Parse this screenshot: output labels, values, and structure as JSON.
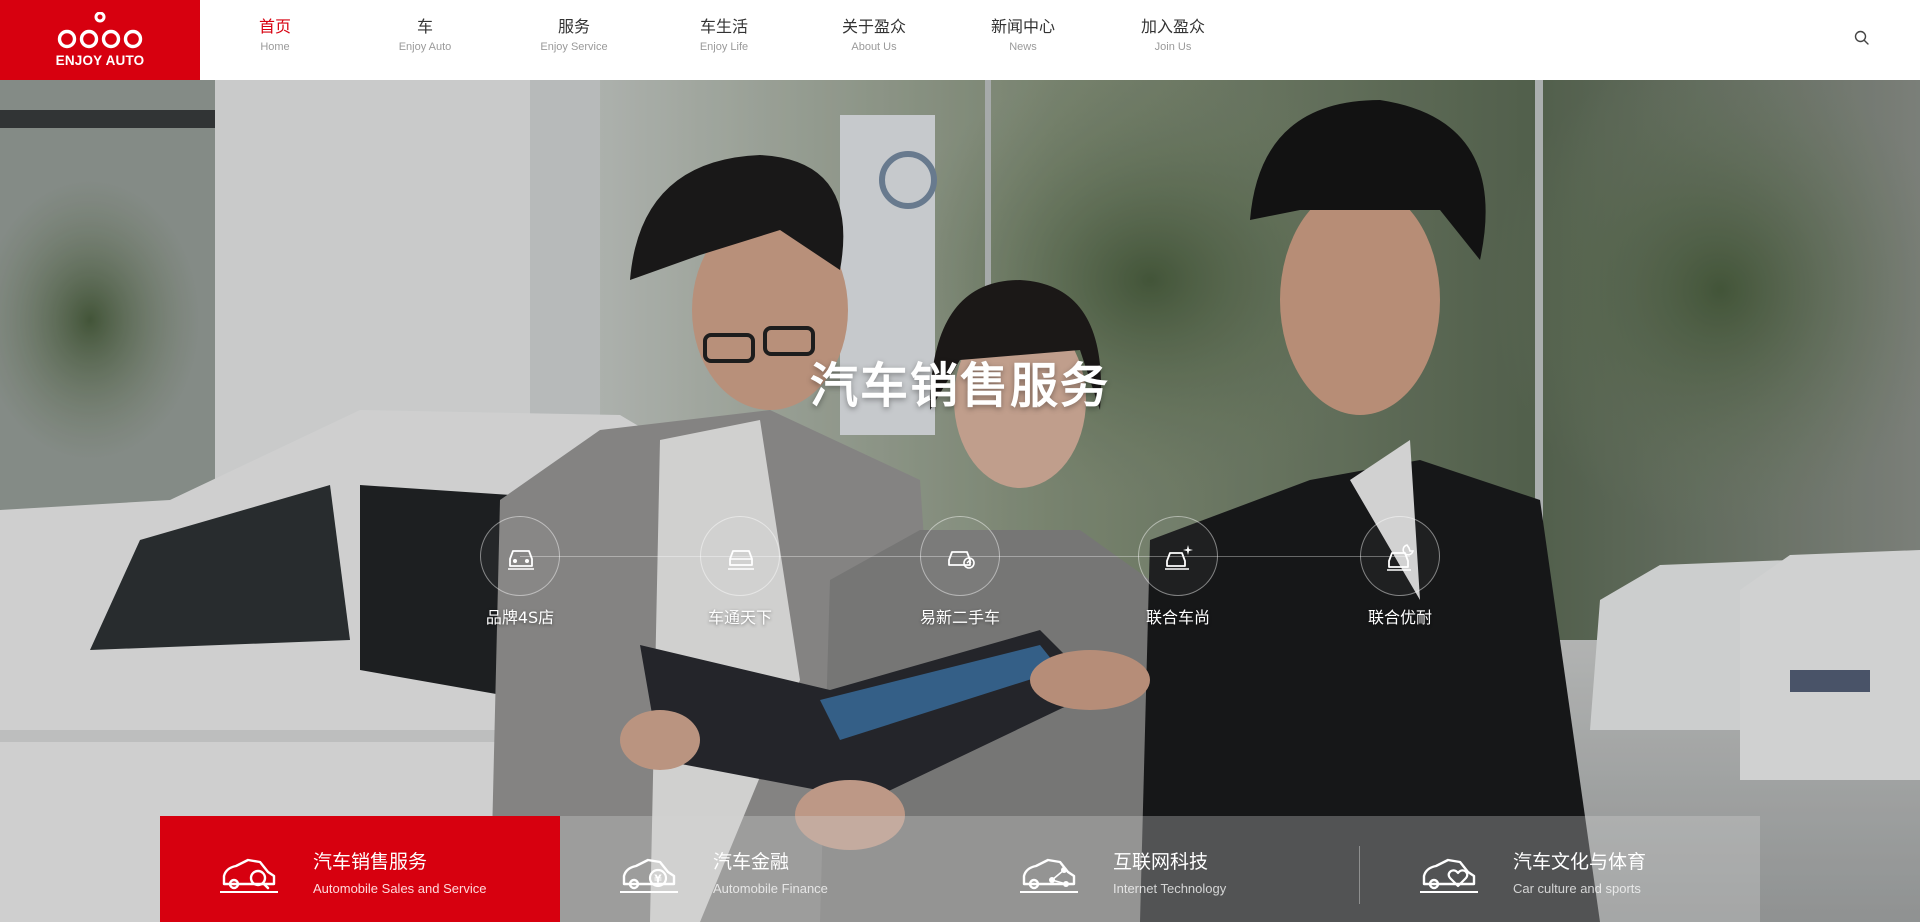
{
  "logo": {
    "text": "ENJOY AUTO"
  },
  "nav": {
    "items": [
      {
        "cn": "首页",
        "en": "Home",
        "active": true
      },
      {
        "cn": "车",
        "en": "Enjoy Auto"
      },
      {
        "cn": "服务",
        "en": "Enjoy Service"
      },
      {
        "cn": "车生活",
        "en": "Enjoy Life"
      },
      {
        "cn": "关于盈众",
        "en": "About Us"
      },
      {
        "cn": "新闻中心",
        "en": "News"
      },
      {
        "cn": "加入盈众",
        "en": "Join Us"
      }
    ],
    "search_icon": "search-icon"
  },
  "hero": {
    "title": "汽车销售服务",
    "services": [
      {
        "label": "品牌4S店",
        "icon": "car-front-icon"
      },
      {
        "label": "车通天下",
        "icon": "car-globe-icon"
      },
      {
        "label": "易新二手车",
        "icon": "car-exchange-icon"
      },
      {
        "label": "联合车尚",
        "icon": "car-sparkle-icon"
      },
      {
        "label": "联合优耐",
        "icon": "car-wrench-icon"
      }
    ]
  },
  "categories": [
    {
      "cn": "汽车销售服务",
      "en": "Automobile Sales and Service",
      "icon": "car-search-icon",
      "active": true
    },
    {
      "cn": "汽车金融",
      "en": "Automobile Finance",
      "icon": "car-yen-icon"
    },
    {
      "cn": "互联网科技",
      "en": "Internet Technology",
      "icon": "car-network-icon"
    },
    {
      "cn": "汽车文化与体育",
      "en": "Car culture and sports",
      "icon": "car-heart-icon"
    }
  ],
  "colors": {
    "brand_red": "#d7000f",
    "nav_text": "#333333",
    "nav_sub": "#9a9a9a"
  }
}
